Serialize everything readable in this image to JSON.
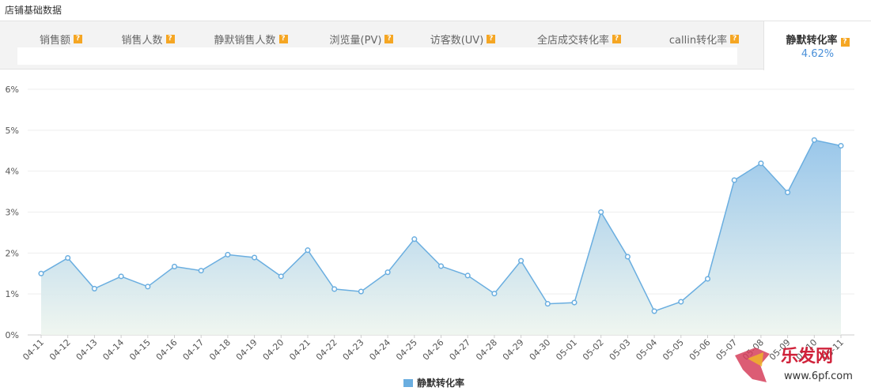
{
  "page_title": "店铺基础数据",
  "tabs": [
    {
      "label": "销售额"
    },
    {
      "label": "销售人数"
    },
    {
      "label": "静默销售人数"
    },
    {
      "label": "浏览量(PV)"
    },
    {
      "label": "访客数(UV)"
    },
    {
      "label": "全店成交转化率"
    },
    {
      "label": "callin转化率"
    }
  ],
  "active_tab": {
    "label": "静默转化率",
    "value": "4.62%"
  },
  "help_glyph": "?",
  "watermark": {
    "brand": "乐发网",
    "url": "www.6pf.com"
  },
  "colors": {
    "line": "#6aaee0",
    "area_top": "#8fc1e8",
    "area_bottom": "#eef5ee",
    "accent": "#4a90d9",
    "help": "#f5a623"
  },
  "chart_data": {
    "type": "area",
    "x": [
      "04-11",
      "04-12",
      "04-13",
      "04-14",
      "04-15",
      "04-16",
      "04-17",
      "04-18",
      "04-19",
      "04-20",
      "04-21",
      "04-22",
      "04-23",
      "04-24",
      "04-25",
      "04-26",
      "04-27",
      "04-28",
      "04-29",
      "04-30",
      "05-01",
      "05-02",
      "05-03",
      "05-04",
      "05-05",
      "05-06",
      "05-07",
      "05-08",
      "05-09",
      "05-10",
      "05-11"
    ],
    "series": [
      {
        "name": "静默转化率",
        "values": [
          1.5,
          1.88,
          1.13,
          1.43,
          1.18,
          1.67,
          1.57,
          1.96,
          1.89,
          1.43,
          2.07,
          1.12,
          1.06,
          1.53,
          2.34,
          1.68,
          1.45,
          1.01,
          1.81,
          0.76,
          0.79,
          3.0,
          1.91,
          0.58,
          0.81,
          1.37,
          3.78,
          4.19,
          3.48,
          4.76,
          4.62
        ]
      }
    ],
    "y_ticks": [
      "0%",
      "1%",
      "2%",
      "3%",
      "4%",
      "5%",
      "6%"
    ],
    "ylim": [
      0,
      6
    ],
    "grid": true,
    "legend": "bottom-center"
  }
}
